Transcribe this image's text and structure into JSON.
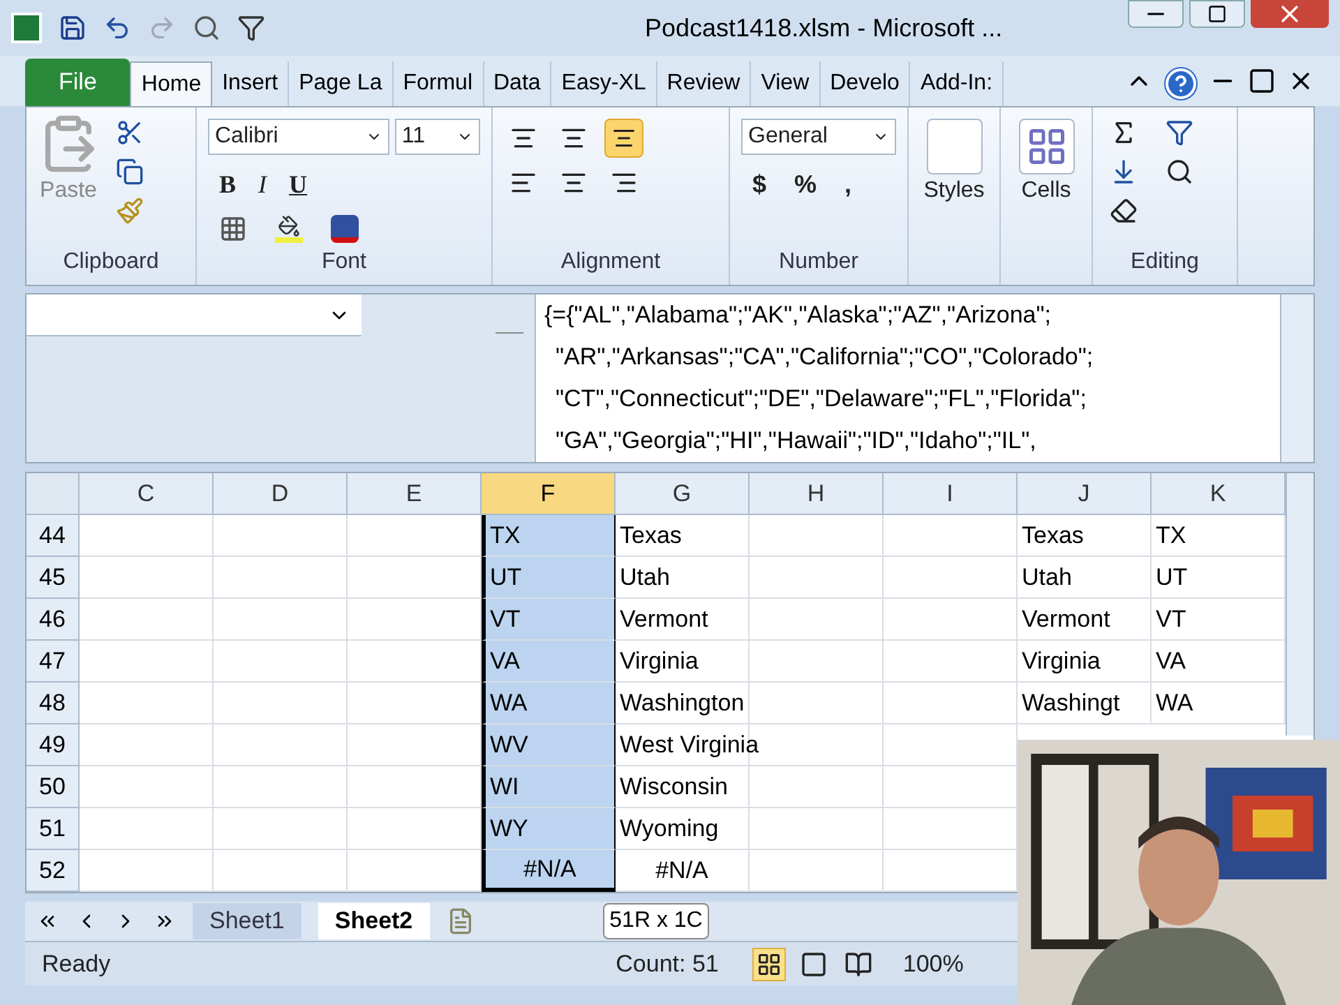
{
  "window": {
    "title": "Podcast1418.xlsm  -  Microsoft ..."
  },
  "ribbon_tabs": [
    {
      "label": "File",
      "kind": "file",
      "selected": false
    },
    {
      "label": "Home",
      "kind": "tab",
      "selected": true
    },
    {
      "label": "Insert",
      "kind": "tab",
      "selected": false
    },
    {
      "label": "Page La",
      "kind": "tab",
      "selected": false
    },
    {
      "label": "Formul",
      "kind": "tab",
      "selected": false
    },
    {
      "label": "Data",
      "kind": "tab",
      "selected": false
    },
    {
      "label": "Easy-XL",
      "kind": "tab",
      "selected": false
    },
    {
      "label": "Review",
      "kind": "tab",
      "selected": false
    },
    {
      "label": "View",
      "kind": "tab",
      "selected": false
    },
    {
      "label": "Develo",
      "kind": "tab",
      "selected": false
    },
    {
      "label": "Add-In:",
      "kind": "tab",
      "selected": false
    }
  ],
  "ribbon": {
    "paste": "Paste",
    "font_name": "Calibri",
    "font_size": "11",
    "bold": "B",
    "italic": "I",
    "underline": "U",
    "number_format": "General",
    "currency": "$",
    "percent": "%",
    "comma": ",",
    "styles": "Styles",
    "cells": "Cells",
    "vertical_alignment": [
      {
        "selected": false
      },
      {
        "selected": false
      },
      {
        "selected": true
      }
    ],
    "groups": [
      "Clipboard",
      "Font",
      "Alignment",
      "Number",
      "Editing"
    ]
  },
  "formula_bar": {
    "lines": [
      "{={\"AL\",\"Alabama\";\"AK\",\"Alaska\";\"AZ\",\"Arizona\";",
      "\"AR\",\"Arkansas\";\"CA\",\"California\";\"CO\",\"Colorado\";",
      "\"CT\",\"Connecticut\";\"DE\",\"Delaware\";\"FL\",\"Florida\";",
      "\"GA\",\"Georgia\";\"HI\",\"Hawaii\";\"ID\",\"Idaho\";\"IL\","
    ]
  },
  "columns": [
    {
      "label": "C",
      "selected": false
    },
    {
      "label": "D",
      "selected": false
    },
    {
      "label": "E",
      "selected": false
    },
    {
      "label": "F",
      "selected": true
    },
    {
      "label": "G",
      "selected": false
    },
    {
      "label": "H",
      "selected": false
    },
    {
      "label": "I",
      "selected": false
    },
    {
      "label": "J",
      "selected": false
    },
    {
      "label": "K",
      "selected": false
    }
  ],
  "rows": [
    {
      "number": "44",
      "f": {
        "text": "TX",
        "selected": true
      },
      "g": {
        "text": "Texas",
        "selected": false
      },
      "j": {
        "text": "Texas",
        "selected": false
      },
      "k": {
        "text": "TX",
        "selected": false
      }
    },
    {
      "number": "45",
      "f": {
        "text": "UT",
        "selected": true
      },
      "g": {
        "text": "Utah",
        "selected": false
      },
      "j": {
        "text": "Utah",
        "selected": false
      },
      "k": {
        "text": "UT",
        "selected": false
      }
    },
    {
      "number": "46",
      "f": {
        "text": "VT",
        "selected": true
      },
      "g": {
        "text": "Vermont",
        "selected": false
      },
      "j": {
        "text": "Vermont",
        "selected": false
      },
      "k": {
        "text": "VT",
        "selected": false
      }
    },
    {
      "number": "47",
      "f": {
        "text": "VA",
        "selected": true
      },
      "g": {
        "text": "Virginia",
        "selected": false
      },
      "j": {
        "text": "Virginia",
        "selected": false
      },
      "k": {
        "text": "VA",
        "selected": false
      }
    },
    {
      "number": "48",
      "f": {
        "text": "WA",
        "selected": true
      },
      "g": {
        "text": "Washington",
        "selected": false
      },
      "j": {
        "text": "Washingt",
        "selected": false
      },
      "k": {
        "text": "WA",
        "selected": false
      }
    },
    {
      "number": "49",
      "f": {
        "text": "WV",
        "selected": true
      },
      "g": {
        "text": "West Virginia",
        "selected": false
      }
    },
    {
      "number": "50",
      "f": {
        "text": "WI",
        "selected": true
      },
      "g": {
        "text": "Wisconsin",
        "selected": false
      }
    },
    {
      "number": "51",
      "f": {
        "text": "WY",
        "selected": true
      },
      "g": {
        "text": "Wyoming",
        "selected": false
      }
    },
    {
      "number": "52",
      "f": {
        "text": "#N/A",
        "selected": true,
        "kind": "error"
      },
      "g": {
        "text": "#N/A",
        "selected": false,
        "kind": "error"
      }
    }
  ],
  "sheet_tabs": [
    {
      "label": "Sheet1",
      "selected": false
    },
    {
      "label": "Sheet2",
      "selected": true
    }
  ],
  "tooltip": "51R x 1C",
  "status_bar": {
    "ready": "Ready",
    "count": "Count: 51",
    "zoom": "100%",
    "views": [
      {
        "selected": true
      },
      {
        "selected": false
      },
      {
        "selected": false
      }
    ]
  }
}
